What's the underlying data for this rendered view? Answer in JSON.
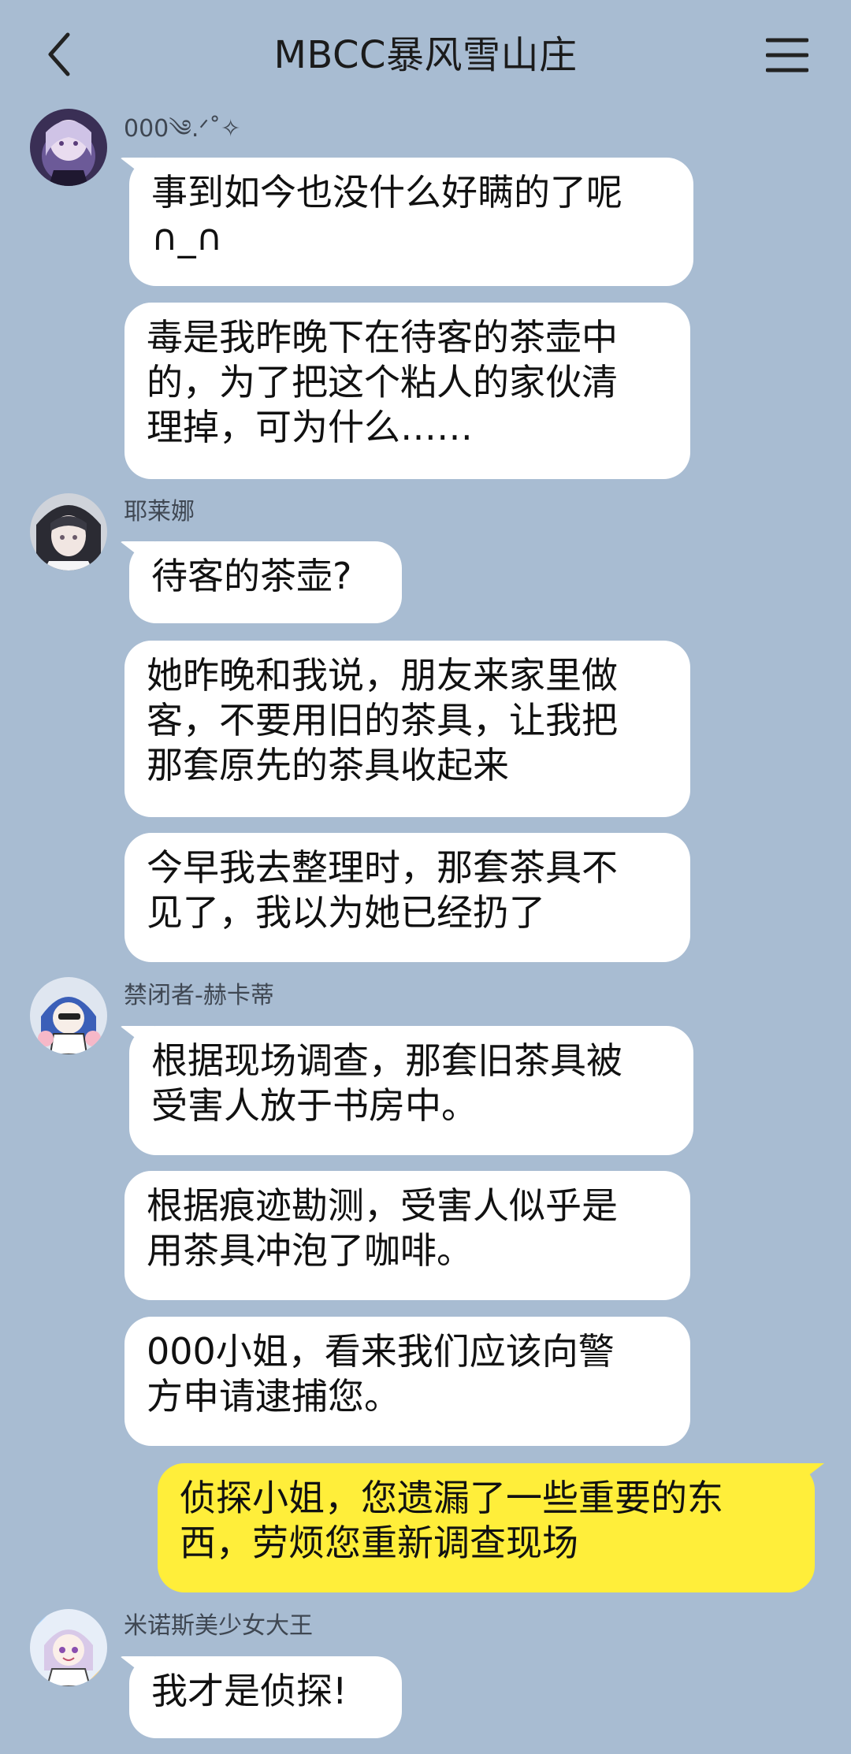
{
  "header": {
    "title": "MBCC暴风雪山庄",
    "back_icon": "chevron-left-icon",
    "menu_icon": "hamburger-menu-icon"
  },
  "colors": {
    "background": "#a8bcd2",
    "incoming_bubble": "#ffffff",
    "outgoing_bubble": "#ffee3a"
  },
  "messages": [
    {
      "sender": "000༄.ᐟ˚✧",
      "text": "事到如今也没什么好瞒的了呢\n∩_∩"
    },
    {
      "sender": "000༄.ᐟ˚✧",
      "text": "毒是我昨晚下在待客的茶壶中\n的，为了把这个粘人的家伙清\n理掉，可为什么……"
    },
    {
      "sender": "耶莱娜",
      "text": "待客的茶壶?"
    },
    {
      "sender": "耶莱娜",
      "text": "她昨晚和我说，朋友来家里做\n客，不要用旧的茶具，让我把\n那套原先的茶具收起来"
    },
    {
      "sender": "耶莱娜",
      "text": "今早我去整理时，那套茶具不\n见了，我以为她已经扔了"
    },
    {
      "sender": "禁闭者-赫卡蒂",
      "text": "根据现场调查，那套旧茶具被\n受害人放于书房中。"
    },
    {
      "sender": "禁闭者-赫卡蒂",
      "text": "根据痕迹勘测，受害人似乎是\n用茶具冲泡了咖啡。"
    },
    {
      "sender": "禁闭者-赫卡蒂",
      "text": "000小姐，看来我们应该向警\n方申请逮捕您。"
    },
    {
      "sender": "",
      "text": "侦探小姐，您遗漏了一些重要的东\n西，劳烦您重新调查现场"
    },
    {
      "sender": "米诺斯美少女大王",
      "text": "我才是侦探!"
    }
  ]
}
